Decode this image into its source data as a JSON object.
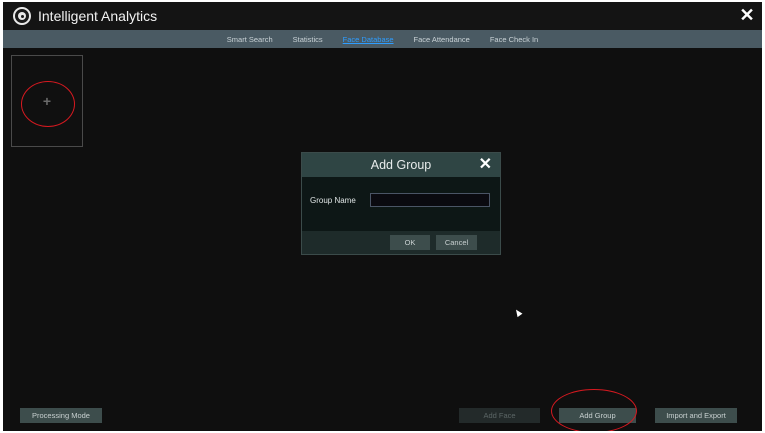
{
  "window": {
    "title": "Intelligent Analytics",
    "icon": "camera-logo-icon",
    "close_glyph": "✕"
  },
  "tabs": [
    {
      "label": "Smart Search",
      "active": false
    },
    {
      "label": "Statistics",
      "active": false
    },
    {
      "label": "Face Database",
      "active": true
    },
    {
      "label": "Face Attendance",
      "active": false
    },
    {
      "label": "Face Check In",
      "active": false
    }
  ],
  "add_tile": {
    "glyph": "+"
  },
  "dialog": {
    "title": "Add Group",
    "close_glyph": "✕",
    "field_label": "Group Name",
    "field_value": "",
    "ok_label": "OK",
    "cancel_label": "Cancel"
  },
  "bottom_buttons": {
    "processing_mode": "Processing Mode",
    "add_face": "Add Face",
    "add_group": "Add Group",
    "import_export": "Import and Export"
  },
  "colors": {
    "active_tab": "#2e9dff",
    "annotation_circle": "#d71920",
    "tab_bar": "#4a5a63",
    "dialog_header": "#2f4544"
  }
}
